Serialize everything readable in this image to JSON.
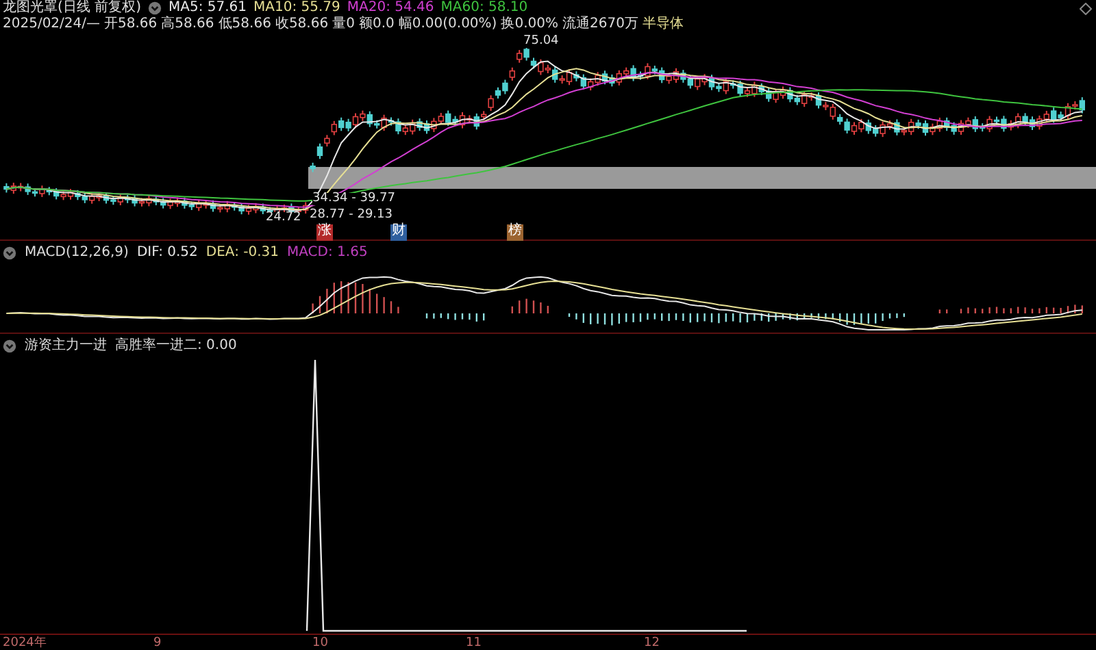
{
  "header": {
    "title": "龙图光罩(日线 前复权)",
    "averages": [
      {
        "label": "MA5: 57.61",
        "color": "#e8e8e8"
      },
      {
        "label": "MA10: 55.79",
        "color": "#e6df94"
      },
      {
        "label": "MA20: 54.46",
        "color": "#d23fd2"
      },
      {
        "label": "MA60: 58.10",
        "color": "#3fc43f"
      }
    ],
    "date": "2025/02/24/—",
    "quote": [
      "开58.66",
      "高58.66",
      "低58.66",
      "收58.66",
      "量0",
      "额0.0",
      "幅0.00(0.00%)",
      "换0.00%",
      "流通2670万"
    ],
    "sector": "半导体"
  },
  "price_panel": {
    "labels": [
      {
        "kind": "peak",
        "text": "75.04"
      },
      {
        "kind": "band",
        "text": "34.34 - 39.77"
      },
      {
        "kind": "low",
        "text": "24.72"
      },
      {
        "kind": "range",
        "text": "28.77 - 29.13"
      }
    ],
    "tags": [
      {
        "text": "涨",
        "color": "#b32a2a"
      },
      {
        "text": "财",
        "color": "#2f5f9e"
      },
      {
        "text": "榜",
        "color": "#9c6430"
      }
    ]
  },
  "macd_panel": {
    "title": "MACD(12,26,9)",
    "values": [
      {
        "label": "DIF: 0.52",
        "color": "#e8e8e8"
      },
      {
        "label": "DEA: -0.31",
        "color": "#e6df94"
      },
      {
        "label": "MACD: 1.65",
        "color": "#c040c0"
      }
    ]
  },
  "indicator_panel": {
    "title": "游资主力一进",
    "value": "高胜率一进二: 0.00"
  },
  "x_axis": [
    "2024年",
    "9",
    "10",
    "11",
    "12"
  ]
}
